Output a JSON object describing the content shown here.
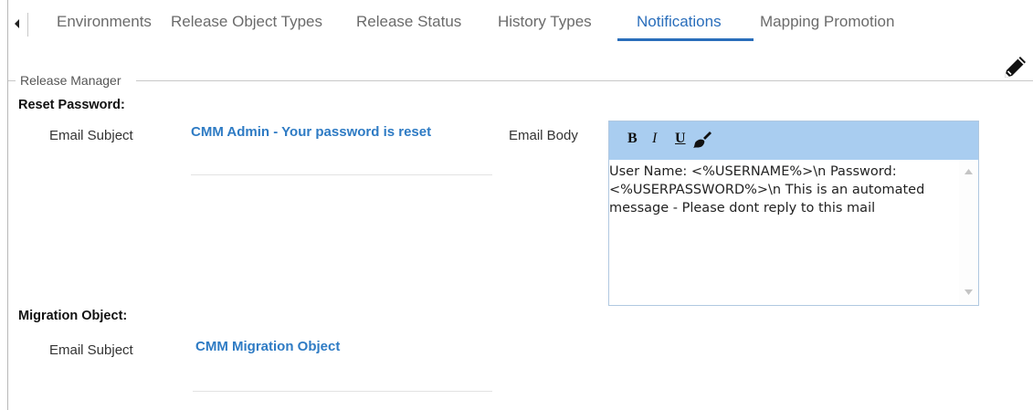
{
  "tabs": [
    {
      "label": "Environments",
      "active": false
    },
    {
      "label": "Release Object Types",
      "active": false
    },
    {
      "label": "Release Status",
      "active": false
    },
    {
      "label": "History Types",
      "active": false
    },
    {
      "label": "Notifications",
      "active": true
    },
    {
      "label": "Mapping Promotion",
      "active": false
    }
  ],
  "fieldset_legend": "Release Manager",
  "reset_password": {
    "title": "Reset Password:",
    "subject_label": "Email Subject",
    "subject_value": "CMM Admin - Your password is reset",
    "body_label": "Email Body",
    "body_text": "User Name: <%USERNAME%>\\n Password: <%USERPASSWORD%>\\n This is an automated message - Please dont reply to this mail"
  },
  "editor_toolbar": {
    "bold": "B",
    "italic": "I",
    "underline": "U"
  },
  "migration_object": {
    "title": "Migration Object:",
    "subject_label": "Email Subject",
    "subject_value": "CMM Migration Object"
  },
  "icons": {
    "tab_scroll": "caret-left-icon",
    "edit": "pencil-icon",
    "format_clear": "paintbrush-icon",
    "scroll_up": "triangle-up-icon",
    "scroll_down": "triangle-down-icon"
  },
  "colors": {
    "accent": "#2a6ebb",
    "link_text": "#2e7bc4",
    "toolbar_bg": "#a9cdf0"
  }
}
